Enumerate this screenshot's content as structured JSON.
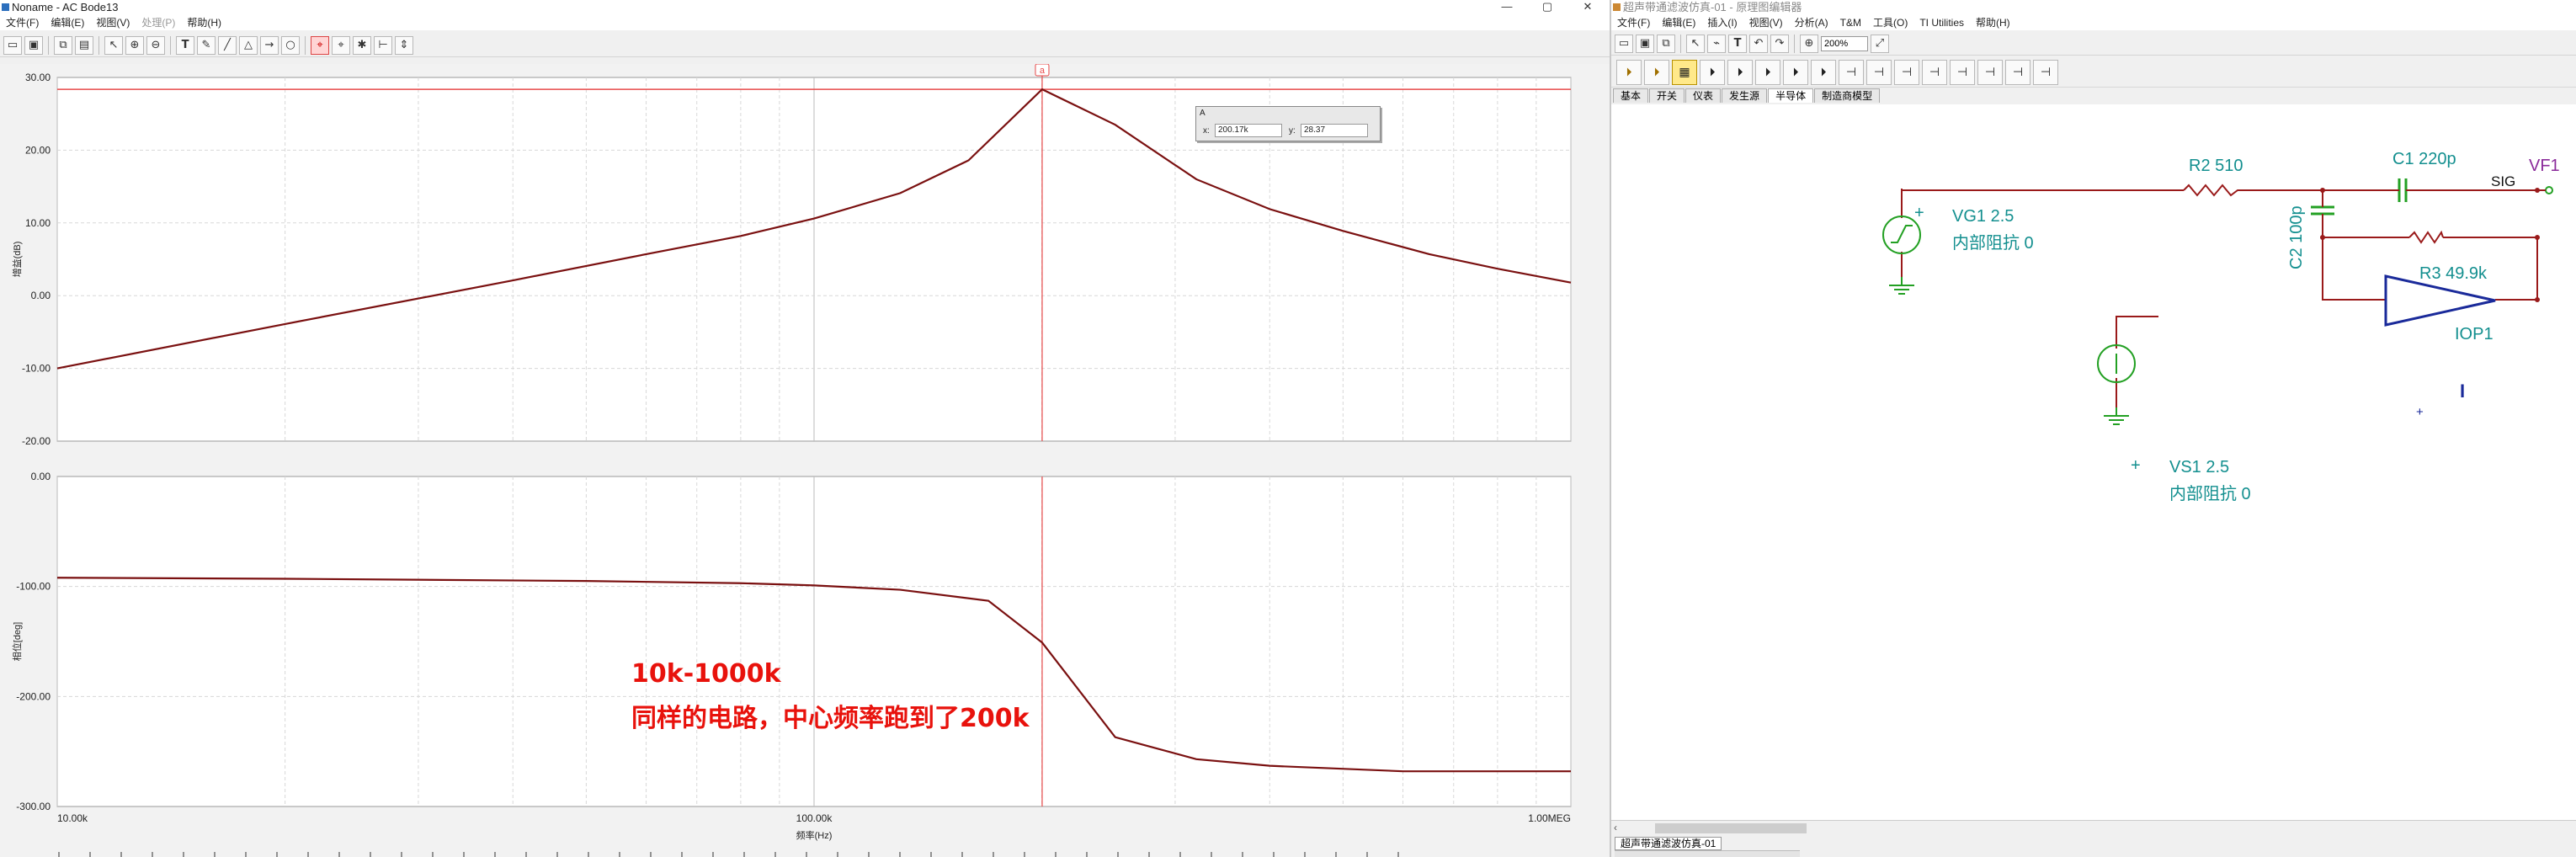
{
  "left_window": {
    "title": "Noname - AC Bode13",
    "controls": {
      "minimize": "—",
      "restore": "▢",
      "close": "✕"
    },
    "menu": [
      "文件(F)",
      "编辑(E)",
      "视图(V)",
      "处理(P)",
      "帮助(H)"
    ],
    "toolbar_icons": [
      "open-icon",
      "save-icon",
      "copy-icon",
      "paste-icon",
      "pointer-icon",
      "zoom-in-icon",
      "zoom-out-icon",
      "text-icon",
      "draw-icon",
      "line-icon",
      "shape-icon",
      "cursor-a-icon",
      "cursor-b-icon",
      "marker-icon",
      "arrow-icon",
      "scroll-icon"
    ],
    "cursor_box": {
      "caption": "A",
      "x_label": "x:",
      "x_value": "200.17k",
      "y_label": "y:",
      "y_value": "28.37"
    },
    "cursor_marker": "a",
    "annotation": {
      "line1": "10k-1000k",
      "line2": "同样的电路，中心频率跑到了200k"
    }
  },
  "chart_data": [
    {
      "type": "line",
      "xscale": "log",
      "xlim": [
        10000,
        1000000
      ],
      "ylim": [
        -20,
        30
      ],
      "yticks": [
        "30.00",
        "20.00",
        "10.00",
        "0.00",
        "-10.00",
        "-20.00"
      ],
      "ylabel": "增益(dB)",
      "xlabel": "",
      "grid": true,
      "x": [
        10000,
        20000,
        40000,
        60000,
        80000,
        100000,
        130000,
        160000,
        200170,
        250000,
        320000,
        400000,
        500000,
        650000,
        800000,
        1000000
      ],
      "series": [
        {
          "values": [
            -10.0,
            -3.9,
            2.1,
            5.7,
            8.2,
            10.6,
            14.1,
            18.6,
            28.37,
            23.5,
            16.0,
            11.9,
            8.9,
            5.7,
            3.7,
            1.8
          ]
        }
      ],
      "cursor_x": 200170,
      "ref_level": 28.37,
      "color": "#7a1010"
    },
    {
      "type": "line",
      "xscale": "log",
      "xlim": [
        10000,
        1000000
      ],
      "ylim": [
        -300,
        0
      ],
      "yticks": [
        "0.00",
        "-100.00",
        "-200.00",
        "-300.00"
      ],
      "xticks": [
        "10.00k",
        "100.00k",
        "1.00MEG"
      ],
      "ylabel": "相位[deg]",
      "xlabel": "频率(Hz)",
      "grid": true,
      "x": [
        10000,
        20000,
        50000,
        80000,
        100000,
        130000,
        170000,
        200170,
        250000,
        320000,
        400000,
        600000,
        1000000
      ],
      "series": [
        {
          "values": [
            -92,
            -93,
            -95,
            -97,
            -99,
            -103,
            -113,
            -151,
            -237,
            -257,
            -263,
            -268,
            -268
          ]
        }
      ],
      "cursor_x": 200170,
      "color": "#7a1010"
    }
  ],
  "right_window": {
    "title": "超声带通滤波仿真-01 - 原理图编辑器",
    "menu": [
      "文件(F)",
      "编辑(E)",
      "插入(I)",
      "视图(V)",
      "分析(A)",
      "T&M",
      "工具(O)",
      "TI Utilities",
      "帮助(H)"
    ],
    "zoom": "200%",
    "component_icons": [
      "battery-icon",
      "source-icon",
      "meter-icon",
      "diode-icon",
      "diode-icon",
      "diode-icon",
      "diode-icon",
      "diode-icon",
      "diode-icon",
      "transistor-icon",
      "transistor-icon",
      "transistor-icon",
      "transistor-icon",
      "transistor-icon",
      "transistor-icon",
      "transistor-icon"
    ],
    "tabs": [
      "基本",
      "开关",
      "仪表",
      "发生源",
      "半导体",
      "制造商模型"
    ],
    "active_tab": 4,
    "doc_tab": "超声带通滤波仿真-01",
    "schematic": {
      "vg1_name": "VG1 2.5",
      "vg1_sub": "内部阻抗 0",
      "r2": "R2 510",
      "c1": "C1 220p",
      "c2": "C2 100p",
      "r3": "R3 49.9k",
      "sig": "SIG",
      "vf1": "VF1",
      "iop1": "IOP1",
      "vs1_name": "VS1 2.5",
      "vs1_sub": "内部阻抗 0",
      "plus": "+",
      "opamp_minus": "I",
      "opamp_plus": "+"
    }
  },
  "colors": {
    "trace": "#7a1010",
    "cursor": "#e84a4a",
    "annotation": "#e8120c",
    "wire": "#9a1a1a",
    "source": "#23a023",
    "resistor": "#9a1a1a",
    "label_teal": "#138f8f",
    "label_purple": "#8a2a9a",
    "opamp": "#1a2a9a"
  }
}
